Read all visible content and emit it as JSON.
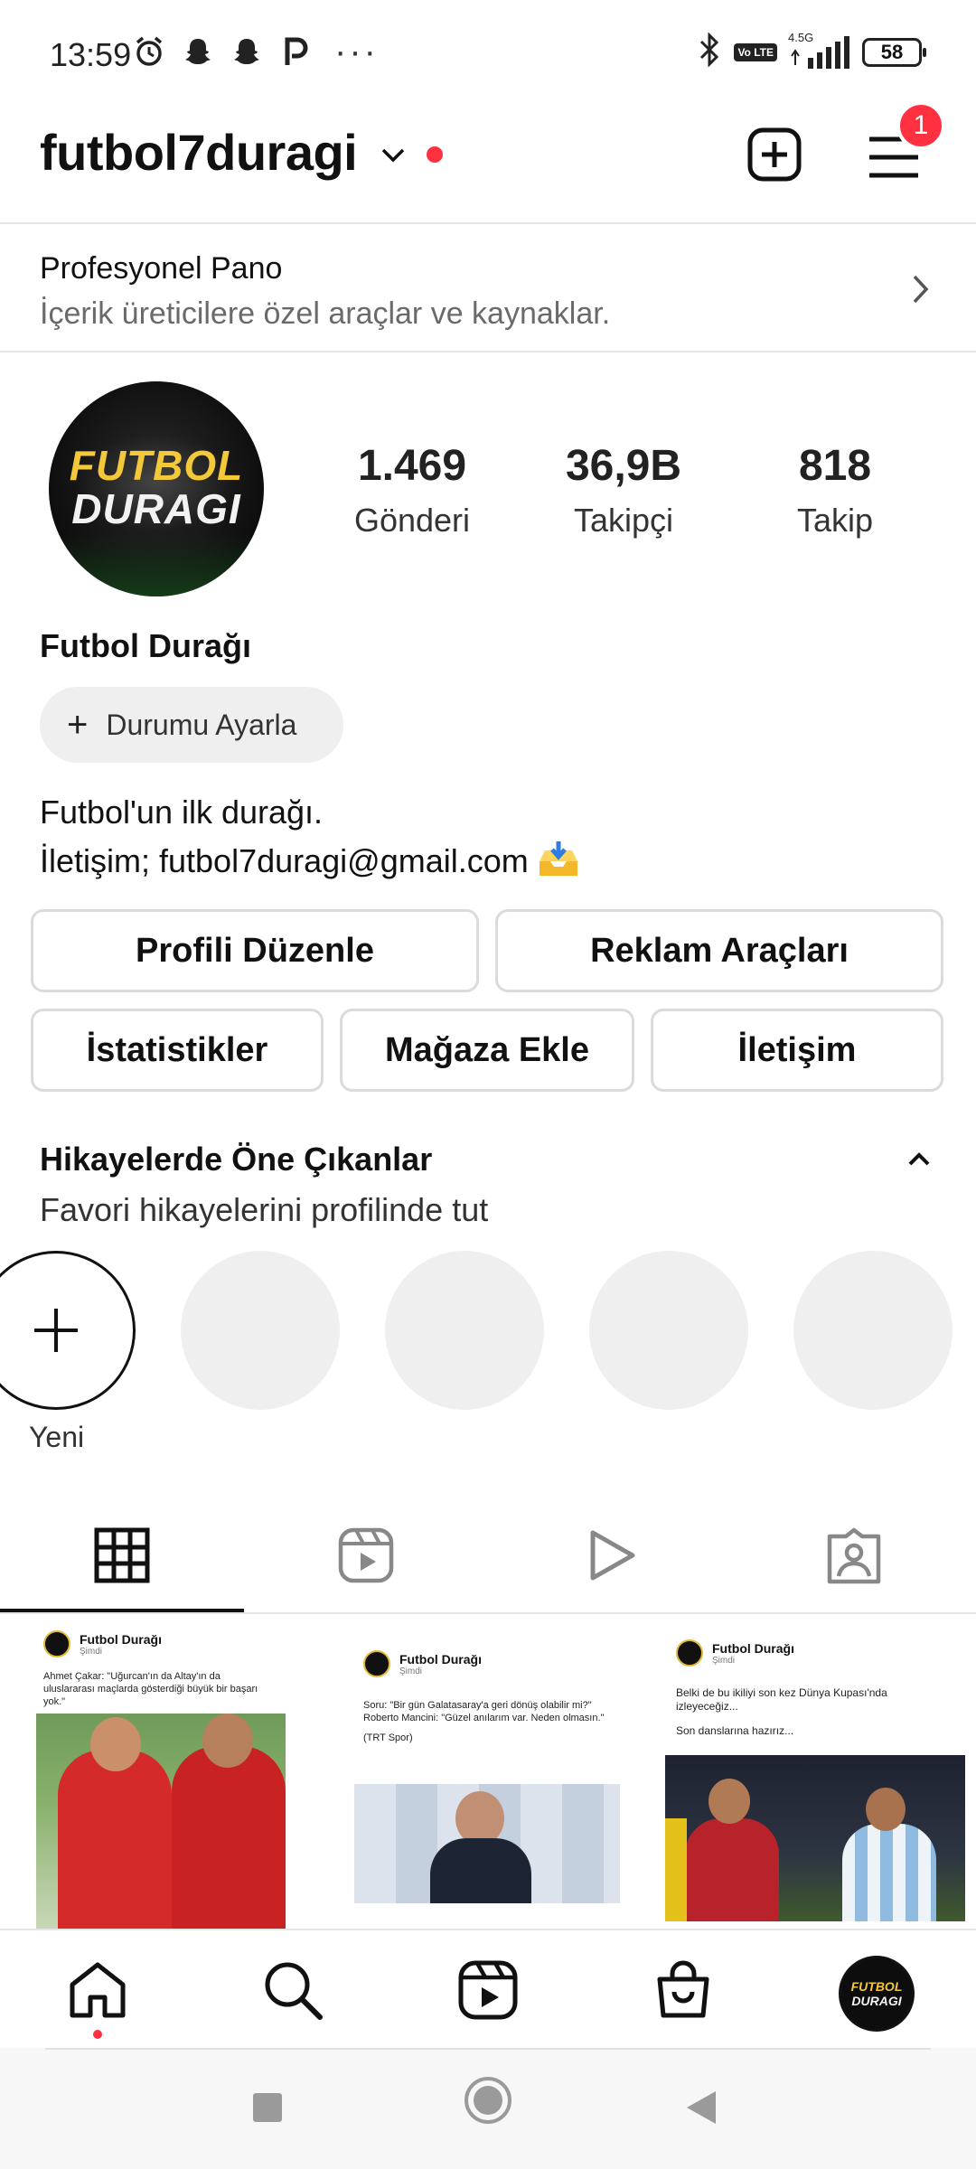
{
  "status_bar": {
    "time": "13:59",
    "network": "4.5G",
    "volte": "Vo LTE",
    "battery": "58",
    "icons": [
      "alarm-icon",
      "snapchat-icon",
      "snapchat-icon",
      "p-icon",
      "more-dots-icon",
      "bluetooth-icon",
      "signal-icon",
      "battery-icon"
    ]
  },
  "header": {
    "username": "futbol7duragi",
    "notification_count": "1"
  },
  "dashboard": {
    "title": "Profesyonel Pano",
    "subtitle": "İçerik üreticilere özel araçlar ve kaynaklar."
  },
  "profile": {
    "avatar_line1": "FUTBOL",
    "avatar_line2": "DURAGI",
    "stats": [
      {
        "value": "1.469",
        "label": "Gönderi"
      },
      {
        "value": "36,9B",
        "label": "Takipçi"
      },
      {
        "value": "818",
        "label": "Takip"
      }
    ],
    "display_name": "Futbol Durağı",
    "status_button": "Durumu Ayarla",
    "bio_line1": "Futbol'un ilk durağı.",
    "bio_line2": "İletişim; futbol7duragi@gmail.com"
  },
  "actions": {
    "edit_profile": "Profili Düzenle",
    "ad_tools": "Reklam Araçları",
    "insights": "İstatistikler",
    "add_shop": "Mağaza Ekle",
    "contact": "İletişim"
  },
  "highlights": {
    "title": "Hikayelerde Öne Çıkanlar",
    "subtitle": "Favori hikayelerini profilinde tut",
    "new_label": "Yeni"
  },
  "posts": [
    {
      "account": "Futbol Durağı",
      "time": "Şimdi",
      "text": "Ahmet Çakar: \"Uğurcan'ın da Altay'ın da uluslararası maçlarda gösterdiği büyük bir başarı yok.\""
    },
    {
      "account": "Futbol Durağı",
      "time": "Şimdi",
      "text1": "Soru: \"Bir gün Galatasaray'a geri dönüş olabilir mi?\"",
      "text2": "Roberto Mancini: \"Güzel anılarım var. Neden olmasın.\"",
      "text3": "(TRT Spor)"
    },
    {
      "account": "Futbol Durağı",
      "time": "Şimdi",
      "text1": "Belki de bu ikiliyi son kez Dünya Kupası'nda izleyeceğiz...",
      "text2": "Son danslarına hazırız..."
    }
  ],
  "colors": {
    "accent_red": "#ff3040",
    "border": "#dbdbdb",
    "brand_yellow": "#f3c93a"
  }
}
